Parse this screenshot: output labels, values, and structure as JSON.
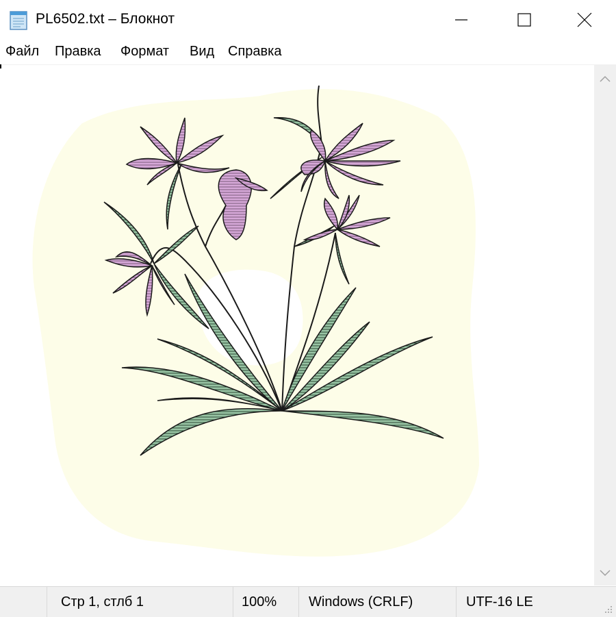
{
  "window": {
    "title": "PL6502.txt – Блокнот",
    "icons": {
      "app": "notepad-icon",
      "minimize": "minimize-icon",
      "maximize": "maximize-icon",
      "close": "close-icon"
    }
  },
  "menu": {
    "items": [
      {
        "label": "Файл"
      },
      {
        "label": "Правка"
      },
      {
        "label": "Формат"
      },
      {
        "label": "Вид"
      },
      {
        "label": "Справка"
      }
    ]
  },
  "editor": {
    "content": "flower-illustration",
    "colors": {
      "background_blob": "#fdfde8",
      "petal": "#d6a8d8",
      "leaf": "#98c4a4",
      "outline": "#1a1a1a"
    }
  },
  "statusbar": {
    "position": "Стр 1, стлб 1",
    "zoom": "100%",
    "line_endings": "Windows (CRLF)",
    "encoding": "UTF-16 LE"
  }
}
